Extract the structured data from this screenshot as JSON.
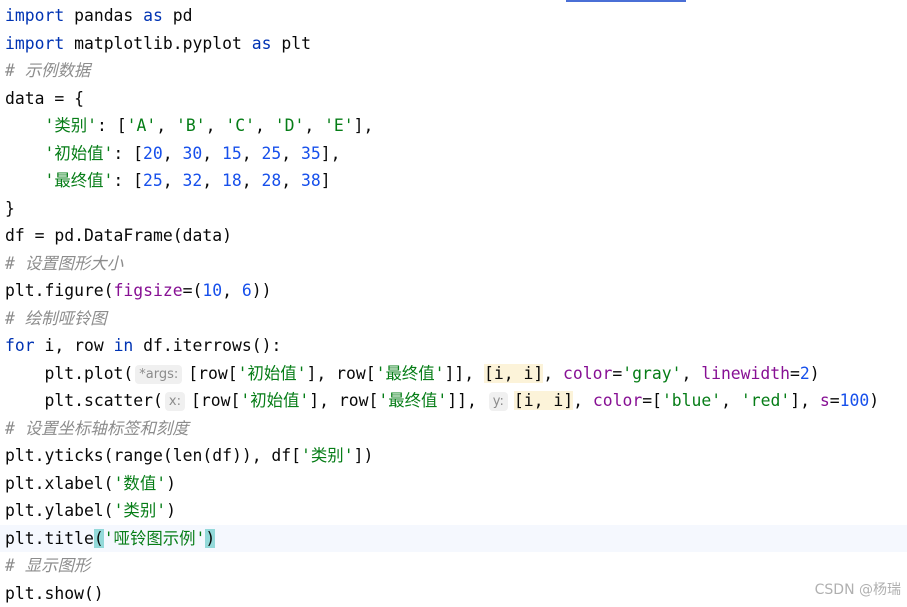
{
  "watermark": "CSDN @杨瑞",
  "colors": {
    "keyword": "#0033b3",
    "string": "#067d17",
    "number": "#1750eb",
    "comment": "#8c8c8c",
    "kwarg": "#871094",
    "current_line": "#f5f8fe"
  },
  "code": {
    "l1": {
      "a": "import",
      "b": " pandas ",
      "c": "as",
      "d": " pd"
    },
    "l2": {
      "a": "import",
      "b": " matplotlib.pyplot ",
      "c": "as",
      "d": " plt"
    },
    "l3": {
      "comment": "# 示例数据"
    },
    "l4": {
      "text": "data = {"
    },
    "l5": {
      "indent": "    ",
      "key": "'类别'",
      "p1": ": [",
      "v1": "'A'",
      "s1": ", ",
      "v2": "'B'",
      "s2": ", ",
      "v3": "'C'",
      "s3": ", ",
      "v4": "'D'",
      "s4": ", ",
      "v5": "'E'",
      "end": "],"
    },
    "l6": {
      "indent": "    ",
      "key": "'初始值'",
      "p1": ": [",
      "v1": "20",
      "s1": ", ",
      "v2": "30",
      "s2": ", ",
      "v3": "15",
      "s3": ", ",
      "v4": "25",
      "s4": ", ",
      "v5": "35",
      "end": "],"
    },
    "l7": {
      "indent": "    ",
      "key": "'最终值'",
      "p1": ": [",
      "v1": "25",
      "s1": ", ",
      "v2": "32",
      "s2": ", ",
      "v3": "18",
      "s3": ", ",
      "v4": "28",
      "s4": ", ",
      "v5": "38",
      "end": "]"
    },
    "l8": {
      "text": "}"
    },
    "l9": {
      "text": "df = pd.DataFrame(data)"
    },
    "l10": {
      "comment": "# 设置图形大小"
    },
    "l11": {
      "a": "plt.figure(",
      "kw": "figsize",
      "b": "=(",
      "n1": "10",
      "c": ", ",
      "n2": "6",
      "d": "))"
    },
    "l12": {
      "comment": "# 绘制哑铃图"
    },
    "l13": {
      "a": "for",
      "b": " i, row ",
      "c": "in",
      "d": " df.iterrows():"
    },
    "l14": {
      "indent": "    ",
      "a": "plt.plot(",
      "hint": "*args:",
      "b": "[row[",
      "s1": "'初始值'",
      "c": "], row[",
      "s2": "'最终值'",
      "d": "]], ",
      "hl": "[i, i]",
      "e": ", ",
      "kw1": "color",
      "f": "=",
      "s3": "'gray'",
      "g": ", ",
      "kw2": "linewidth",
      "h": "=",
      "n1": "2",
      "i": ")"
    },
    "l15": {
      "indent": "    ",
      "a": "plt.scatter(",
      "hint1": "x:",
      "b": "[row[",
      "s1": "'初始值'",
      "c": "], row[",
      "s2": "'最终值'",
      "d": "]], ",
      "hint2": "y:",
      "hl": "[i, i]",
      "e": ", ",
      "kw1": "color",
      "f": "=[",
      "s3": "'blue'",
      "g": ", ",
      "s4": "'red'",
      "h": "], ",
      "kw2": "s",
      "i": "=",
      "n1": "100",
      "j": ")"
    },
    "l16": {
      "comment": "# 设置坐标轴标签和刻度"
    },
    "l17": {
      "a": "plt.yticks(range(len(df)), df[",
      "s1": "'类别'",
      "b": "])"
    },
    "l18": {
      "a": "plt.xlabel(",
      "s1": "'数值'",
      "b": ")"
    },
    "l19": {
      "a": "plt.ylabel(",
      "s1": "'类别'",
      "b": ")"
    },
    "l20": {
      "a": "plt.title",
      "p1": "(",
      "s1": "'哑铃图示例'",
      "p2": ")"
    },
    "l21": {
      "comment": "# 显示图形"
    },
    "l22": {
      "text": "plt.show()"
    }
  }
}
